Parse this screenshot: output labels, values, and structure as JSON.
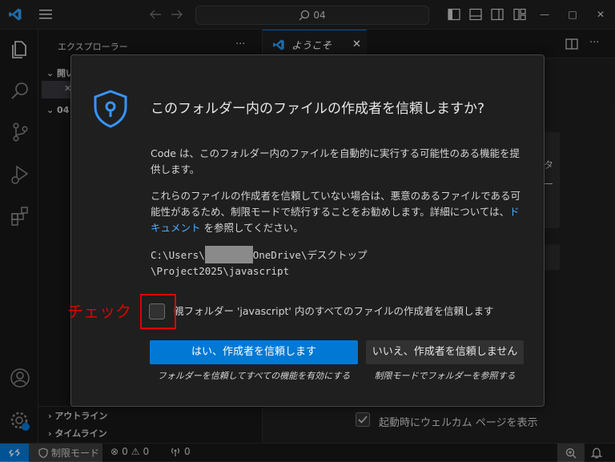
{
  "titlebar": {
    "search_text": "04"
  },
  "sidebar": {
    "title": "エクスプローラー",
    "more": "···",
    "section_open": "開い",
    "section_folder": "04",
    "section_outline": "アウトライン",
    "section_timeline": "タイムライン"
  },
  "editor": {
    "tab_label": "ようこそ",
    "bg_text_1": "タ",
    "bg_text_2": "ー",
    "show_on_startup": "起動時にウェルカム ページを表示"
  },
  "dialog": {
    "title": "このフォルダー内のファイルの作成者を信頼しますか?",
    "para1": "Code は、このフォルダー内のファイルを自動的に実行する可能性のある機能を提供します。",
    "para2_before": "これらのファイルの作成者を信頼していない場合は、悪意のあるファイルである可能性があるため、制限モードで続行することをお勧めします。詳細については、",
    "para2_link": "ドキュメント",
    "para2_after": " を参照してください。",
    "path_prefix": "C:\\Users\\",
    "path_suffix": "OneDrive\\デスクトップ",
    "path_line2": "\\Project2025\\javascript",
    "checkbox_label": "親フォルダー 'javascript' 内のすべてのファイルの作成者を信頼します",
    "yes_button": "はい、作成者を信頼します",
    "yes_sub": "フォルダーを信頼してすべての機能を有効にする",
    "no_button": "いいえ、作成者を信頼しません",
    "no_sub": "制限モードでフォルダーを参照する"
  },
  "annotation": {
    "check_label": "チェック",
    "color": "#e00000"
  },
  "statusbar": {
    "restricted_mode": "制限モード",
    "errors": "0",
    "warnings": "0",
    "ports": "0"
  },
  "colors": {
    "accent": "#0078d4",
    "link": "#4daafc",
    "shield": "#3794ff"
  }
}
